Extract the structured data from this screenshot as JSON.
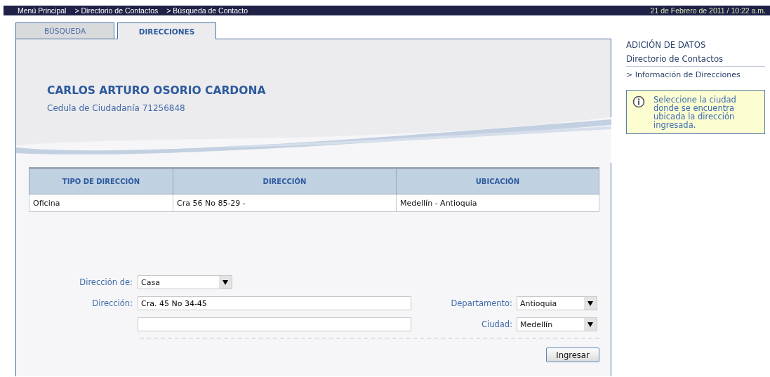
{
  "breadcrumb": [
    "Menú Principal",
    "> Directorio de Contactos",
    "> Búsqueda de Contacto"
  ],
  "datetime": "21 de Febrero de 2011 / 10:22 a.m.",
  "tabs": [
    {
      "label": "BÚSQUEDA",
      "selected": false
    },
    {
      "label": "DIRECCIONES",
      "selected": true
    }
  ],
  "contact": {
    "name": "CARLOS ARTURO OSORIO CARDONA",
    "document": "Cedula de Ciudadanía 71256848"
  },
  "table": {
    "columns": [
      "TIPO DE DIRECCIÓN",
      "DIRECCIÓN",
      "UBICACIÓN"
    ],
    "rows": [
      [
        "Oficina",
        "Cra 56 No 85-29 -",
        "Medellín - Antioquia"
      ]
    ]
  },
  "form": {
    "address_type": {
      "label": "Dirección de:",
      "value": "Casa"
    },
    "address": {
      "label": "Dirección:",
      "value": "Cra. 45 No 34-45"
    },
    "department": {
      "label": "Departamento:",
      "value": "Antioquia"
    },
    "city": {
      "label": "Ciudad:",
      "value": "Medellín"
    },
    "submit": "Ingresar"
  },
  "sidebar": {
    "title": "ADICIÓN DE DATOS",
    "subtitle": "Directorio de Contactos",
    "link": "> Información de Direcciones",
    "info": "Seleccione la ciudad donde se encuentra ubicada la dirección ingresada."
  }
}
